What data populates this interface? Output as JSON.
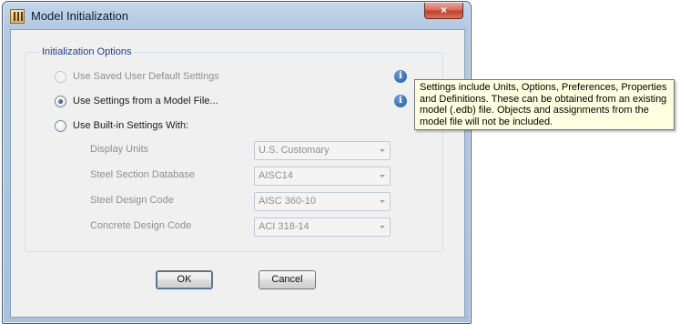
{
  "window": {
    "title": "Model Initialization",
    "close_glyph": "×"
  },
  "group": {
    "title": "Initialization Options"
  },
  "options": [
    {
      "label": "Use Saved User Default Settings",
      "enabled": false,
      "checked": false
    },
    {
      "label": "Use Settings from a Model File...",
      "enabled": true,
      "checked": true
    },
    {
      "label": "Use Built-in Settings With:",
      "enabled": true,
      "checked": false
    }
  ],
  "fields": [
    {
      "label": "Display Units",
      "value": "U.S. Customary"
    },
    {
      "label": "Steel Section Database",
      "value": "AISC14"
    },
    {
      "label": "Steel Design Code",
      "value": "AISC 360-10"
    },
    {
      "label": "Concrete Design Code",
      "value": "ACI 318-14"
    }
  ],
  "info_glyph": "i",
  "buttons": {
    "ok": "OK",
    "cancel": "Cancel"
  },
  "tooltip": {
    "text": "Settings include Units, Options, Preferences, Properties and Definitions. These can be obtained from an existing model (.edb) file. Objects and assignments from the model file will not be included."
  }
}
